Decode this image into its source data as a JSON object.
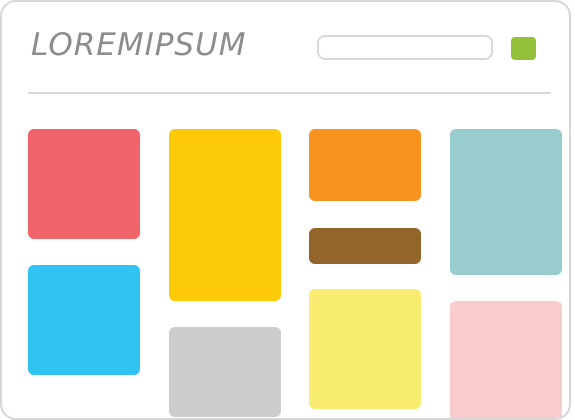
{
  "brand": {
    "text": "LOREMIPSUM"
  },
  "header": {
    "search_value": "",
    "search_placeholder": "",
    "action_color": "#94c13a"
  },
  "tiles": [
    {
      "name": "tile-red",
      "color": "#f16469"
    },
    {
      "name": "tile-blue",
      "color": "#31c3f1"
    },
    {
      "name": "tile-yellow",
      "color": "#fdca08"
    },
    {
      "name": "tile-gray",
      "color": "#cdcdcd"
    },
    {
      "name": "tile-orange",
      "color": "#f7941d"
    },
    {
      "name": "tile-brown",
      "color": "#94652b"
    },
    {
      "name": "tile-light-yellow",
      "color": "#f8ec71"
    },
    {
      "name": "tile-teal",
      "color": "#99cdcd"
    },
    {
      "name": "tile-pink",
      "color": "#f9cbcc"
    }
  ]
}
